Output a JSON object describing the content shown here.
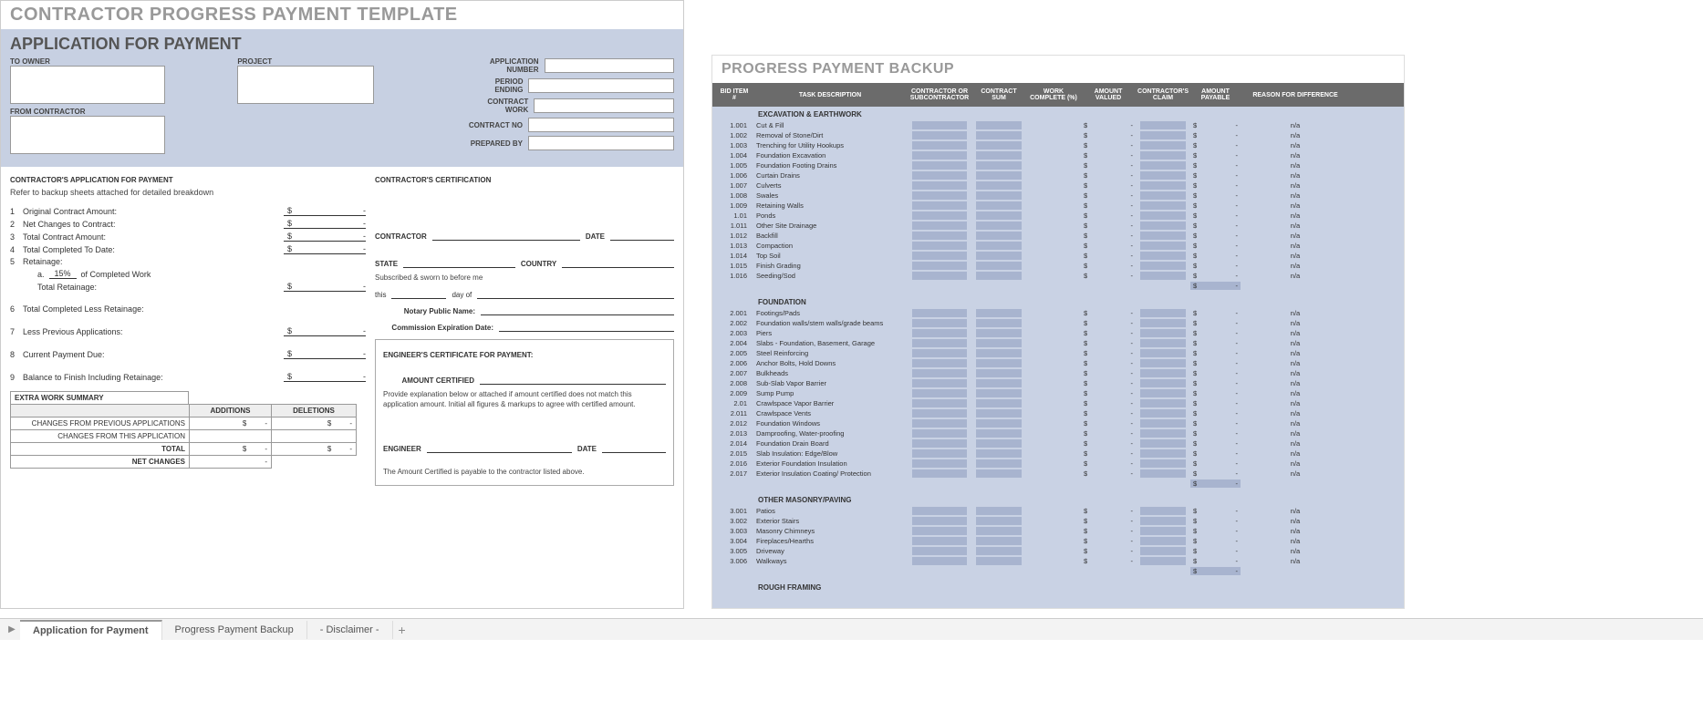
{
  "main_title": "CONTRACTOR PROGRESS PAYMENT TEMPLATE",
  "app": {
    "title": "APPLICATION FOR PAYMENT",
    "labels": {
      "to_owner": "TO OWNER",
      "project": "PROJECT",
      "from_contractor": "FROM CONTRACTOR",
      "app_number": "APPLICATION NUMBER",
      "period_ending": "PERIOD ENDING",
      "contract_work": "CONTRACT WORK",
      "contract_no": "CONTRACT NO",
      "prepared_by": "PREPARED BY"
    },
    "section_left_title": "CONTRACTOR'S APPLICATION FOR PAYMENT",
    "section_left_note": "Refer to backup sheets attached for detailed breakdown",
    "lines": {
      "l1": "Original Contract Amount:",
      "l2": "Net Changes to Contract:",
      "l3": "Total Contract Amount:",
      "l4": "Total Completed To Date:",
      "l5": "Retainage:",
      "l5a_pct": "15%",
      "l5a_txt": "of Completed Work",
      "l5a_pre": "a.",
      "l5_total": "Total Retainage:",
      "l6": "Total Completed Less Retainage:",
      "l7": "Less Previous Applications:",
      "l8": "Current Payment Due:",
      "l9": "Balance to Finish Including Retainage:"
    },
    "money": {
      "sym": "$",
      "dash": "-"
    },
    "section_right_title": "CONTRACTOR'S CERTIFICATION",
    "cert": {
      "contractor": "CONTRACTOR",
      "date": "DATE",
      "state": "STATE",
      "country": "COUNTRY",
      "sworn": "Subscribed & sworn to before me",
      "this": "this",
      "dayof": "day of",
      "notary": "Notary Public Name:",
      "commission": "Commission Expiration Date:"
    },
    "eng": {
      "title": "ENGINEER'S CERTIFICATE FOR PAYMENT:",
      "amount": "AMOUNT CERTIFIED",
      "text": "Provide explanation below or attached if amount certified does not match this application amount. Initial all figures & markups to agree with certified amount.",
      "engineer": "ENGINEER",
      "date": "DATE",
      "payable": "The Amount Certified is payable to the contractor listed above."
    },
    "extra": {
      "title": "EXTRA WORK SUMMARY",
      "additions": "ADDITIONS",
      "deletions": "DELETIONS",
      "r1": "CHANGES FROM PREVIOUS APPLICATIONS",
      "r2": "CHANGES FROM THIS APPLICATION",
      "r3": "TOTAL",
      "r4": "NET CHANGES"
    }
  },
  "backup": {
    "title": "PROGRESS PAYMENT BACKUP",
    "headers": {
      "bid": "BID ITEM #",
      "desc": "TASK DESCRIPTION",
      "sub": "CONTRACTOR OR SUBCONTRACTOR",
      "sum": "CONTRACT SUM",
      "wc": "WORK COMPLETE (%)",
      "av": "AMOUNT VALUED",
      "cc": "CONTRACTOR'S CLAIM",
      "ap": "AMOUNT PAYABLE",
      "reason": "REASON FOR DIFFERENCE"
    },
    "na": "n/a",
    "sections": [
      {
        "title": "EXCAVATION & EARTHWORK",
        "items": [
          {
            "id": "1.001",
            "desc": "Cut & Fill"
          },
          {
            "id": "1.002",
            "desc": "Removal of Stone/Dirt"
          },
          {
            "id": "1.003",
            "desc": "Trenching for Utility Hookups"
          },
          {
            "id": "1.004",
            "desc": "Foundation Excavation"
          },
          {
            "id": "1.005",
            "desc": "Foundation Footing Drains"
          },
          {
            "id": "1.006",
            "desc": "Curtain Drains"
          },
          {
            "id": "1.007",
            "desc": "Culverts"
          },
          {
            "id": "1.008",
            "desc": "Swales"
          },
          {
            "id": "1.009",
            "desc": "Retaining Walls"
          },
          {
            "id": "1.01",
            "desc": "Ponds"
          },
          {
            "id": "1.011",
            "desc": "Other Site Drainage"
          },
          {
            "id": "1.012",
            "desc": "Backfill"
          },
          {
            "id": "1.013",
            "desc": "Compaction"
          },
          {
            "id": "1.014",
            "desc": "Top Soil"
          },
          {
            "id": "1.015",
            "desc": "Finish Grading"
          },
          {
            "id": "1.016",
            "desc": "Seeding/Sod"
          }
        ]
      },
      {
        "title": "FOUNDATION",
        "items": [
          {
            "id": "2.001",
            "desc": "Footings/Pads"
          },
          {
            "id": "2.002",
            "desc": "Foundation walls/stem walls/grade beams"
          },
          {
            "id": "2.003",
            "desc": "Piers"
          },
          {
            "id": "2.004",
            "desc": "Slabs - Foundation, Basement, Garage"
          },
          {
            "id": "2.005",
            "desc": "Steel Reinforcing"
          },
          {
            "id": "2.006",
            "desc": "Anchor Bolts, Hold Downs"
          },
          {
            "id": "2.007",
            "desc": "Bulkheads"
          },
          {
            "id": "2.008",
            "desc": "Sub-Slab Vapor Barrier"
          },
          {
            "id": "2.009",
            "desc": "Sump Pump"
          },
          {
            "id": "2.01",
            "desc": "Crawlspace Vapor Barrier"
          },
          {
            "id": "2.011",
            "desc": "Crawlspace Vents"
          },
          {
            "id": "2.012",
            "desc": "Foundation Windows"
          },
          {
            "id": "2.013",
            "desc": "Damproofing, Water-proofing"
          },
          {
            "id": "2.014",
            "desc": "Foundation Drain Board"
          },
          {
            "id": "2.015",
            "desc": "Slab Insulation: Edge/Blow"
          },
          {
            "id": "2.016",
            "desc": "Exterior Foundation Insulation"
          },
          {
            "id": "2.017",
            "desc": "Exterior Insulation Coating/ Protection"
          }
        ]
      },
      {
        "title": "OTHER MASONRY/PAVING",
        "items": [
          {
            "id": "3.001",
            "desc": "Patios"
          },
          {
            "id": "3.002",
            "desc": "Exterior Stairs"
          },
          {
            "id": "3.003",
            "desc": "Masonry Chimneys"
          },
          {
            "id": "3.004",
            "desc": "Fireplaces/Hearths"
          },
          {
            "id": "3.005",
            "desc": "Driveway"
          },
          {
            "id": "3.006",
            "desc": "Walkways"
          }
        ]
      },
      {
        "title": "ROUGH FRAMING",
        "items": []
      }
    ]
  },
  "tabs": {
    "t1": "Application for Payment",
    "t2": "Progress Payment Backup",
    "t3": "- Disclaimer -"
  }
}
